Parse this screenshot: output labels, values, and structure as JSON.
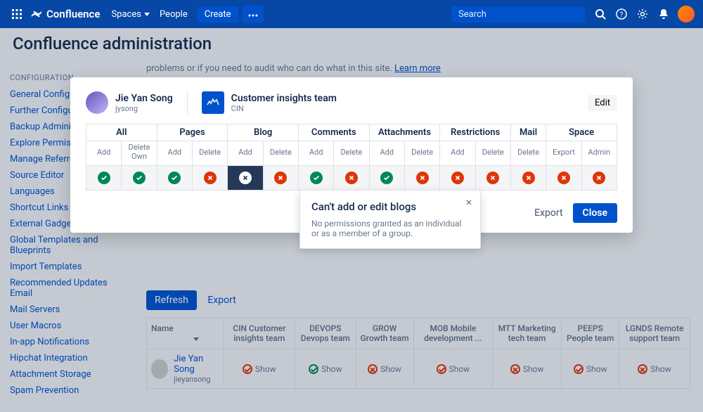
{
  "topnav": {
    "brand": "Confluence",
    "spaces": "Spaces",
    "people": "People",
    "create": "Create",
    "search_placeholder": "Search"
  },
  "page": {
    "title": "Confluence administration",
    "intro_prefix": "problems or if you need to audit who can do what in this site. ",
    "learn_more": "Learn more"
  },
  "sidebar": {
    "section": "CONFIGURATION",
    "items": [
      "General Configuration",
      "Further Configuration",
      "Backup Administration",
      "Explore Permissions",
      "Manage Referrers",
      "Source Editor",
      "Languages",
      "Shortcut Links",
      "External Gadgets",
      "Global Templates and Blueprints",
      "Import Templates",
      "Recommended Updates Email",
      "Mail Servers",
      "User Macros",
      "In-app Notifications",
      "Hipchat Integration",
      "Attachment Storage",
      "Spam Prevention"
    ]
  },
  "toolbar": {
    "refresh": "Refresh",
    "export": "Export"
  },
  "table": {
    "name_col": "Name",
    "columns": [
      "CIN Customer insights team",
      "DEVOPS Devops team",
      "GROW Growth team",
      "MOB Mobile development ...",
      "MTT Marketing tech team",
      "PEEPS People team",
      "LGNDS Remote support team"
    ],
    "user": {
      "name": "Jie Yan Song",
      "handle": "jieyansong"
    },
    "show": "Show",
    "statuses": [
      "orange-check",
      "green-check",
      "red-x",
      "orange-check",
      "red-x",
      "orange-check",
      "red-x"
    ]
  },
  "modal": {
    "user": {
      "name": "Jie Yan Song",
      "handle": "jysong"
    },
    "space": {
      "name": "Customer insights team",
      "key": "CIN"
    },
    "edit": "Edit",
    "groups": [
      {
        "label": "All",
        "subs": [
          "Add",
          "Delete Own"
        ]
      },
      {
        "label": "Pages",
        "subs": [
          "Add",
          "Delete"
        ]
      },
      {
        "label": "Blog",
        "subs": [
          "Add",
          "Delete"
        ]
      },
      {
        "label": "Comments",
        "subs": [
          "Add",
          "Delete"
        ]
      },
      {
        "label": "Attachments",
        "subs": [
          "Add",
          "Delete"
        ]
      },
      {
        "label": "Restrictions",
        "subs": [
          "Add",
          "Delete"
        ]
      },
      {
        "label": "Mail",
        "subs": [
          "Delete"
        ]
      },
      {
        "label": "Space",
        "subs": [
          "Export",
          "Admin"
        ]
      }
    ],
    "row": [
      "ok",
      "ok",
      "ok",
      "no",
      "active-no",
      "no",
      "ok",
      "no",
      "ok",
      "no",
      "no",
      "no",
      "no",
      "no",
      "no"
    ],
    "footer": {
      "export": "Export",
      "close": "Close"
    }
  },
  "popover": {
    "title": "Can't add or edit blogs",
    "body": "No permissions granted as an individual or as a member of a group."
  }
}
